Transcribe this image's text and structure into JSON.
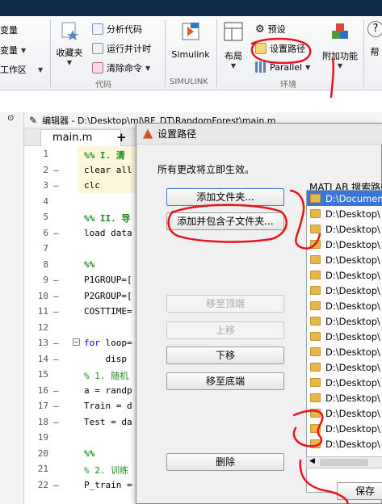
{
  "ribbon": {
    "left_items": [
      "变量",
      "变量",
      "工作区"
    ],
    "favorites": "收藏夹",
    "analyze": "分析代码",
    "run_time": "运行并计时",
    "clear_cmd": "清除命令",
    "simulink": "Simulink",
    "layout": "布局",
    "preferences": "预设",
    "set_path": "设置路径",
    "parallel": "Parallel",
    "addons": "附加功能",
    "help": "帮",
    "groups": {
      "code": "代码",
      "simulink": "SIMULINK",
      "env": "环境"
    }
  },
  "editor": {
    "title": "编辑器 - D:\\Desktop\\ml\\RF_DT\\RandomForest\\main.m",
    "tab": "main.m",
    "lines": [
      {
        "n": "1",
        "d": "",
        "t": "%% I. 清",
        "cls": "cmb",
        "cell": true
      },
      {
        "n": "2",
        "d": "–",
        "t": "clear all",
        "cls": "",
        "cell": true
      },
      {
        "n": "3",
        "d": "–",
        "t": "clc",
        "cls": "",
        "cell": true
      },
      {
        "n": "4",
        "d": "",
        "t": "",
        "cls": "",
        "cell": false
      },
      {
        "n": "5",
        "d": "",
        "t": "%% II. 导",
        "cls": "cmb",
        "cell": false
      },
      {
        "n": "6",
        "d": "–",
        "t": "load data",
        "cls": "",
        "cell": false
      },
      {
        "n": "7",
        "d": "",
        "t": "",
        "cls": "",
        "cell": false
      },
      {
        "n": "8",
        "d": "",
        "t": "%%",
        "cls": "cmb",
        "cell": false
      },
      {
        "n": "9",
        "d": "–",
        "t": "P1GROUP=[",
        "cls": "",
        "cell": false
      },
      {
        "n": "10",
        "d": "–",
        "t": "P2GROUP=[",
        "cls": "",
        "cell": false
      },
      {
        "n": "11",
        "d": "–",
        "t": "COSTTIME=",
        "cls": "",
        "cell": false
      },
      {
        "n": "12",
        "d": "",
        "t": "",
        "cls": "",
        "cell": false
      },
      {
        "n": "13",
        "d": "–",
        "t": "for loop=",
        "cls": "kwfor",
        "cell": false
      },
      {
        "n": "14",
        "d": "–",
        "t": "    disp",
        "cls": "",
        "cell": false
      },
      {
        "n": "15",
        "d": "",
        "t": "% 1. 随机",
        "cls": "cm",
        "cell": false
      },
      {
        "n": "16",
        "d": "–",
        "t": "a = randp",
        "cls": "",
        "cell": false
      },
      {
        "n": "17",
        "d": "–",
        "t": "Train = d",
        "cls": "",
        "cell": false
      },
      {
        "n": "18",
        "d": "–",
        "t": "Test = da",
        "cls": "",
        "cell": false
      },
      {
        "n": "19",
        "d": "",
        "t": "",
        "cls": "",
        "cell": false
      },
      {
        "n": "20",
        "d": "",
        "t": "%%",
        "cls": "cmb",
        "cell": false
      },
      {
        "n": "21",
        "d": "",
        "t": "% 2. 训练",
        "cls": "cm",
        "cell": false
      },
      {
        "n": "22",
        "d": "–",
        "t": "P_train =",
        "cls": "",
        "cell": false
      }
    ]
  },
  "dialog": {
    "title": "设置路径",
    "notice": "所有更改将立即生效。",
    "search_path_label": "MATLAB 搜索路径",
    "buttons": {
      "add_folder": "添加文件夹...",
      "add_with_subfolders": "添加并包含子文件夹...",
      "move_top": "移至顶端",
      "move_up": "上移",
      "move_down": "下移",
      "move_bottom": "移至底端",
      "remove": "删除",
      "save": "保存"
    },
    "paths": [
      "D:\\Documen",
      "D:\\Desktop\\",
      "D:\\Desktop\\",
      "D:\\Desktop\\",
      "D:\\Desktop\\",
      "D:\\Desktop\\",
      "D:\\Desktop\\",
      "D:\\Desktop\\",
      "D:\\Desktop\\",
      "D:\\Desktop\\",
      "D:\\Desktop\\",
      "D:\\Desktop\\",
      "D:\\Desktop\\",
      "D:\\Desktop\\",
      "D:\\Desktop\\",
      "D:\\Desktop\\",
      "D:\\Desktop\\"
    ]
  },
  "colors": {
    "annotation": "#e8141c",
    "selection": "#3a76d8"
  }
}
